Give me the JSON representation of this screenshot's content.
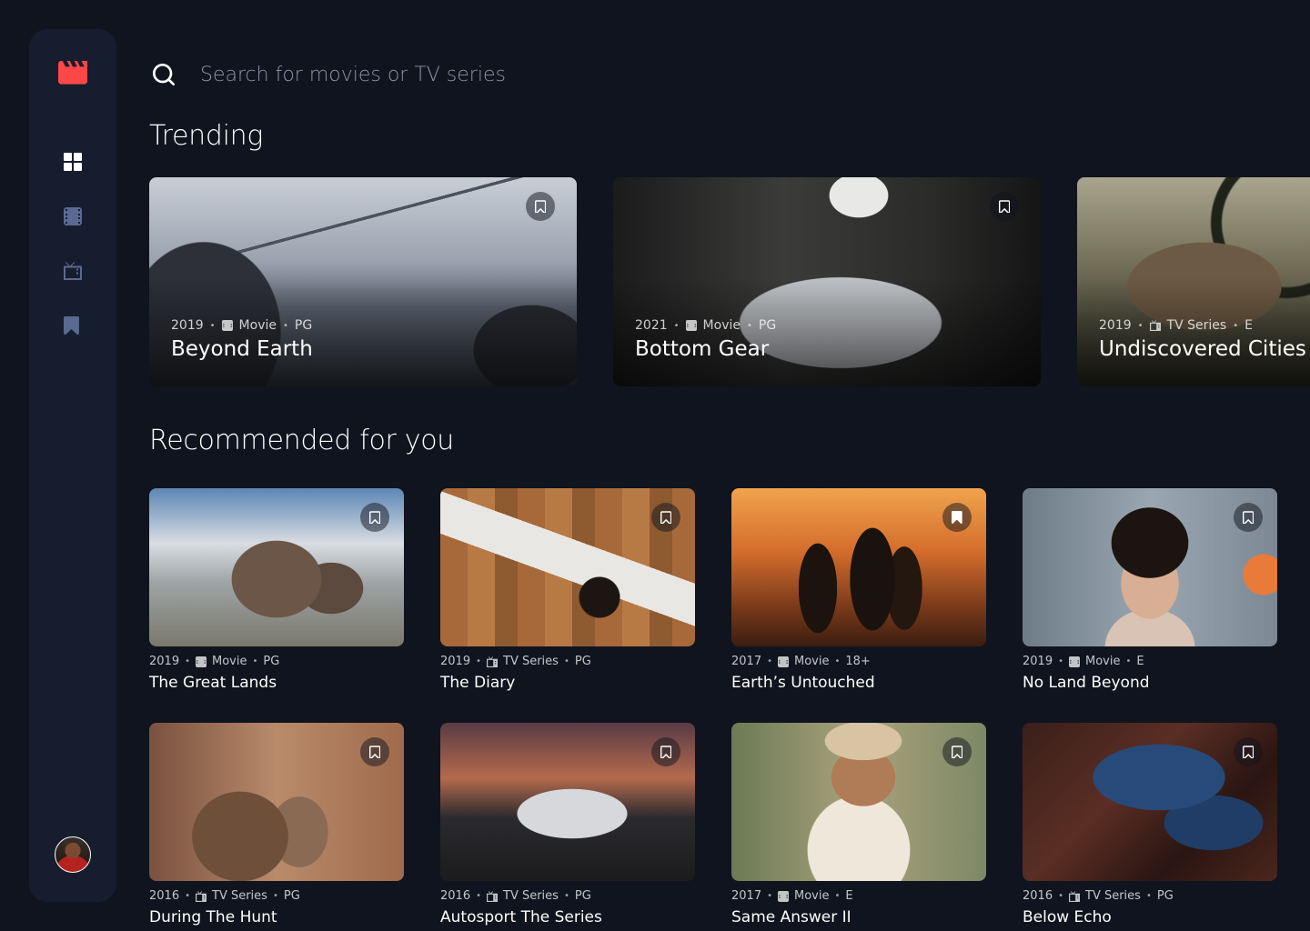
{
  "search": {
    "placeholder": "Search for movies or TV series"
  },
  "sections": {
    "trending": "Trending",
    "recommended": "Recommended for you"
  },
  "colors": {
    "background": "#10141E",
    "sidebar": "#161D2F",
    "accent": "#FC4747",
    "nav_active": "#FFFFFF",
    "nav_inactive": "#5A698F"
  },
  "nav": [
    {
      "name": "home",
      "icon": "grid-icon",
      "active": true
    },
    {
      "name": "movies",
      "icon": "film-icon",
      "active": false
    },
    {
      "name": "tv-series",
      "icon": "tv-icon",
      "active": false
    },
    {
      "name": "bookmarks",
      "icon": "bookmark-icon",
      "active": false
    }
  ],
  "trending": [
    {
      "year": "2019",
      "category": "Movie",
      "rating": "PG",
      "title": "Beyond Earth"
    },
    {
      "year": "2021",
      "category": "Movie",
      "rating": "PG",
      "title": "Bottom Gear"
    },
    {
      "year": "2019",
      "category": "TV Series",
      "rating": "E",
      "title": "Undiscovered Cities"
    }
  ],
  "recommended": [
    {
      "year": "2019",
      "category": "Movie",
      "rating": "PG",
      "title": "The Great Lands"
    },
    {
      "year": "2019",
      "category": "TV Series",
      "rating": "PG",
      "title": "The Diary"
    },
    {
      "year": "2017",
      "category": "Movie",
      "rating": "18+",
      "title": "Earth’s Untouched"
    },
    {
      "year": "2019",
      "category": "Movie",
      "rating": "E",
      "title": "No Land Beyond"
    },
    {
      "year": "2016",
      "category": "TV Series",
      "rating": "PG",
      "title": "During The Hunt"
    },
    {
      "year": "2016",
      "category": "TV Series",
      "rating": "PG",
      "title": "Autosport The Series"
    },
    {
      "year": "2017",
      "category": "Movie",
      "rating": "E",
      "title": "Same Answer II"
    },
    {
      "year": "2016",
      "category": "TV Series",
      "rating": "PG",
      "title": "Below Echo"
    }
  ]
}
